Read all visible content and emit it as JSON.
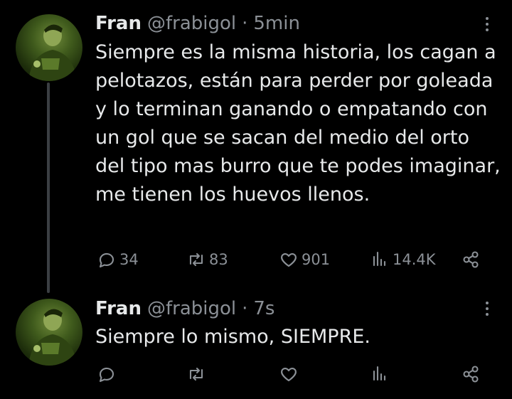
{
  "tweets": [
    {
      "name": "Fran",
      "handle": "@frabigol",
      "time_sep": "·",
      "time": "5min",
      "text": "Siempre es la misma historia, los cagan a pelotazos, están para perder por goleada y lo terminan ganando o empatando con un gol que se sacan del medio del orto del tipo mas burro que te podes imaginar, me tienen los huevos llenos.",
      "replies": "34",
      "retweets": "83",
      "likes": "901",
      "views": "14.4K"
    },
    {
      "name": "Fran",
      "handle": "@frabigol",
      "time_sep": "·",
      "time": "7s",
      "text": "Siempre lo mismo, SIEMPRE.",
      "replies": "",
      "retweets": "",
      "likes": "",
      "views": ""
    }
  ],
  "icons": {
    "reply": "reply-icon",
    "retweet": "retweet-icon",
    "like": "heart-icon",
    "views": "views-chart-icon",
    "share": "share-icon",
    "more": "more-dots-icon"
  },
  "colors": {
    "background": "#000000",
    "text": "#e7e9ea",
    "secondary": "#8b9096",
    "thread_line": "#3b3f43",
    "avatar_tint": "#4f6f22"
  }
}
